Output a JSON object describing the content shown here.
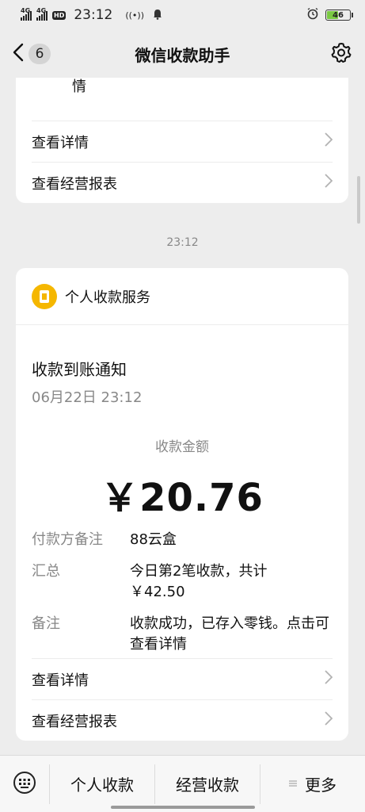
{
  "status_bar": {
    "signal1": "4G",
    "signal2": "4G",
    "hd": "HD",
    "time": "23:12",
    "battery": "46"
  },
  "nav": {
    "badge": "6",
    "title": "微信收款助手"
  },
  "top_card": {
    "trunc_text": "情",
    "links": [
      {
        "label": "查看详情"
      },
      {
        "label": "查看经营报表"
      }
    ]
  },
  "timestamp": "23:12",
  "notification": {
    "service_name": "个人收款服务",
    "title": "收款到账通知",
    "date": "06月22日  23:12",
    "amount_label": "收款金额",
    "amount": "￥20.76",
    "details": [
      {
        "key": "付款方备注",
        "value": "88云盒"
      },
      {
        "key": "汇总",
        "value": "今日第2笔收款，共计￥42.50"
      },
      {
        "key": "备注",
        "value": "收款成功，已存入零钱。点击可查看详情"
      }
    ],
    "links": [
      {
        "label": "查看详情"
      },
      {
        "label": "查看经营报表"
      }
    ]
  },
  "tabbar": {
    "tabs": [
      {
        "label": "个人收款"
      },
      {
        "label": "经营收款"
      },
      {
        "label": "更多"
      }
    ]
  },
  "colors": {
    "background": "#ededed",
    "service_logo": "#f5b700",
    "battery_fill": "#7ac943"
  }
}
